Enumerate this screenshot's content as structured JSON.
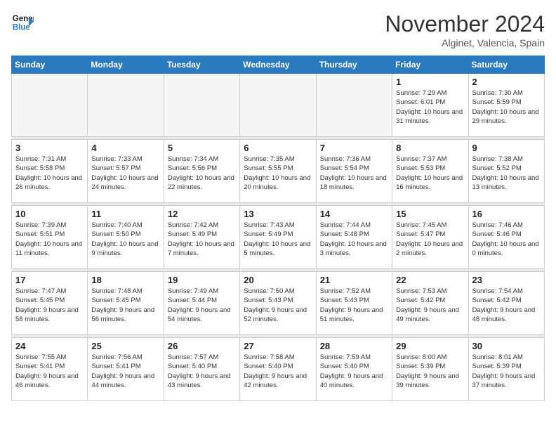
{
  "header": {
    "logo_line1": "General",
    "logo_line2": "Blue",
    "month_year": "November 2024",
    "location": "Alginet, Valencia, Spain"
  },
  "weekdays": [
    "Sunday",
    "Monday",
    "Tuesday",
    "Wednesday",
    "Thursday",
    "Friday",
    "Saturday"
  ],
  "weeks": [
    [
      {
        "day": "",
        "empty": true
      },
      {
        "day": "",
        "empty": true
      },
      {
        "day": "",
        "empty": true
      },
      {
        "day": "",
        "empty": true
      },
      {
        "day": "",
        "empty": true
      },
      {
        "day": "1",
        "sunrise": "7:29 AM",
        "sunset": "6:01 PM",
        "daylight": "10 hours and 31 minutes."
      },
      {
        "day": "2",
        "sunrise": "7:30 AM",
        "sunset": "5:59 PM",
        "daylight": "10 hours and 29 minutes."
      }
    ],
    [
      {
        "day": "3",
        "sunrise": "7:31 AM",
        "sunset": "5:58 PM",
        "daylight": "10 hours and 26 minutes."
      },
      {
        "day": "4",
        "sunrise": "7:33 AM",
        "sunset": "5:57 PM",
        "daylight": "10 hours and 24 minutes."
      },
      {
        "day": "5",
        "sunrise": "7:34 AM",
        "sunset": "5:56 PM",
        "daylight": "10 hours and 22 minutes."
      },
      {
        "day": "6",
        "sunrise": "7:35 AM",
        "sunset": "5:55 PM",
        "daylight": "10 hours and 20 minutes."
      },
      {
        "day": "7",
        "sunrise": "7:36 AM",
        "sunset": "5:54 PM",
        "daylight": "10 hours and 18 minutes."
      },
      {
        "day": "8",
        "sunrise": "7:37 AM",
        "sunset": "5:53 PM",
        "daylight": "10 hours and 16 minutes."
      },
      {
        "day": "9",
        "sunrise": "7:38 AM",
        "sunset": "5:52 PM",
        "daylight": "10 hours and 13 minutes."
      }
    ],
    [
      {
        "day": "10",
        "sunrise": "7:39 AM",
        "sunset": "5:51 PM",
        "daylight": "10 hours and 11 minutes."
      },
      {
        "day": "11",
        "sunrise": "7:40 AM",
        "sunset": "5:50 PM",
        "daylight": "10 hours and 9 minutes."
      },
      {
        "day": "12",
        "sunrise": "7:42 AM",
        "sunset": "5:49 PM",
        "daylight": "10 hours and 7 minutes."
      },
      {
        "day": "13",
        "sunrise": "7:43 AM",
        "sunset": "5:49 PM",
        "daylight": "10 hours and 5 minutes."
      },
      {
        "day": "14",
        "sunrise": "7:44 AM",
        "sunset": "5:48 PM",
        "daylight": "10 hours and 3 minutes."
      },
      {
        "day": "15",
        "sunrise": "7:45 AM",
        "sunset": "5:47 PM",
        "daylight": "10 hours and 2 minutes."
      },
      {
        "day": "16",
        "sunrise": "7:46 AM",
        "sunset": "5:46 PM",
        "daylight": "10 hours and 0 minutes."
      }
    ],
    [
      {
        "day": "17",
        "sunrise": "7:47 AM",
        "sunset": "5:45 PM",
        "daylight": "9 hours and 58 minutes."
      },
      {
        "day": "18",
        "sunrise": "7:48 AM",
        "sunset": "5:45 PM",
        "daylight": "9 hours and 56 minutes."
      },
      {
        "day": "19",
        "sunrise": "7:49 AM",
        "sunset": "5:44 PM",
        "daylight": "9 hours and 54 minutes."
      },
      {
        "day": "20",
        "sunrise": "7:50 AM",
        "sunset": "5:43 PM",
        "daylight": "9 hours and 52 minutes."
      },
      {
        "day": "21",
        "sunrise": "7:52 AM",
        "sunset": "5:43 PM",
        "daylight": "9 hours and 51 minutes."
      },
      {
        "day": "22",
        "sunrise": "7:53 AM",
        "sunset": "5:42 PM",
        "daylight": "9 hours and 49 minutes."
      },
      {
        "day": "23",
        "sunrise": "7:54 AM",
        "sunset": "5:42 PM",
        "daylight": "9 hours and 48 minutes."
      }
    ],
    [
      {
        "day": "24",
        "sunrise": "7:55 AM",
        "sunset": "5:41 PM",
        "daylight": "9 hours and 46 minutes."
      },
      {
        "day": "25",
        "sunrise": "7:56 AM",
        "sunset": "5:41 PM",
        "daylight": "9 hours and 44 minutes."
      },
      {
        "day": "26",
        "sunrise": "7:57 AM",
        "sunset": "5:40 PM",
        "daylight": "9 hours and 43 minutes."
      },
      {
        "day": "27",
        "sunrise": "7:58 AM",
        "sunset": "5:40 PM",
        "daylight": "9 hours and 42 minutes."
      },
      {
        "day": "28",
        "sunrise": "7:59 AM",
        "sunset": "5:40 PM",
        "daylight": "9 hours and 40 minutes."
      },
      {
        "day": "29",
        "sunrise": "8:00 AM",
        "sunset": "5:39 PM",
        "daylight": "9 hours and 39 minutes."
      },
      {
        "day": "30",
        "sunrise": "8:01 AM",
        "sunset": "5:39 PM",
        "daylight": "9 hours and 37 minutes."
      }
    ]
  ]
}
